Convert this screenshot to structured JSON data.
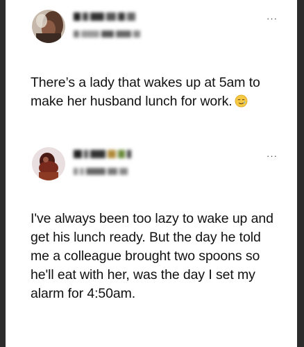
{
  "posts": [
    {
      "text": "There’s a lady that wakes up at 5am to make her husband lunch for work.",
      "emoji": "tear-smile-emoji",
      "more_label": "···"
    },
    {
      "text": "I've always been too lazy to wake up and get his lunch ready. But the day he told me a colleague brought two spoons so he'll eat with her, was the day I set my alarm for 4:50am.",
      "more_label": "···"
    }
  ],
  "colors": {
    "background": "#ffffff",
    "text": "#111111",
    "outer_border": "#2c2c2c"
  }
}
